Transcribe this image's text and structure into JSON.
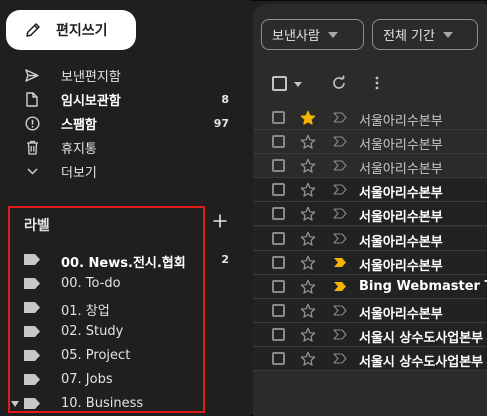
{
  "compose": {
    "label": "편지쓰기",
    "icon": "pencil-icon"
  },
  "nav": [
    {
      "name": "sent",
      "label": "보낸편지함",
      "icon": "send-icon",
      "bold": false,
      "count": ""
    },
    {
      "name": "drafts",
      "label": "임시보관함",
      "icon": "draft-file-icon",
      "bold": true,
      "count": "8"
    },
    {
      "name": "spam",
      "label": "스팸함",
      "icon": "spam-alert-icon",
      "bold": true,
      "count": "97"
    },
    {
      "name": "trash",
      "label": "휴지통",
      "icon": "trash-icon",
      "bold": false,
      "count": ""
    },
    {
      "name": "more",
      "label": "더보기",
      "icon": "chevron-down-icon",
      "bold": false,
      "count": ""
    }
  ],
  "labels_section": {
    "title": "라벨",
    "add_icon": "plus-icon",
    "items": [
      {
        "label": "00. News.전시.협회",
        "bold": true,
        "count": "2"
      },
      {
        "label": "00. To-do",
        "bold": false,
        "count": ""
      },
      {
        "label": "01. 창업",
        "bold": false,
        "count": ""
      },
      {
        "label": "02. Study",
        "bold": false,
        "count": ""
      },
      {
        "label": "05. Project",
        "bold": false,
        "count": ""
      },
      {
        "label": "07. Jobs",
        "bold": false,
        "count": ""
      },
      {
        "label": "10. Business",
        "bold": false,
        "count": ""
      }
    ]
  },
  "filters": [
    {
      "label": "보낸사람"
    },
    {
      "label": "전체 기간"
    }
  ],
  "toolbar": {
    "select_icon": "checkbox-icon",
    "refresh_icon": "refresh-icon",
    "more_icon": "more-vert-icon"
  },
  "colors": {
    "highlight_box": "#e01b1b",
    "star": "#f4b400",
    "important": "#f4b400"
  },
  "emails": [
    {
      "sender": "서울아리수본부",
      "unread": false,
      "starred": true,
      "important": false
    },
    {
      "sender": "서울아리수본부",
      "unread": false,
      "starred": false,
      "important": false
    },
    {
      "sender": "서울아리수본부",
      "unread": false,
      "starred": false,
      "important": false
    },
    {
      "sender": "서울아리수본부",
      "unread": true,
      "starred": false,
      "important": false
    },
    {
      "sender": "서울아리수본부",
      "unread": true,
      "starred": false,
      "important": false
    },
    {
      "sender": "서울아리수본부",
      "unread": true,
      "starred": false,
      "important": false
    },
    {
      "sender": "서울아리수본부",
      "unread": true,
      "starred": false,
      "important": true
    },
    {
      "sender": "Bing Webmaster To",
      "unread": true,
      "starred": false,
      "important": true
    },
    {
      "sender": "서울아리수본부",
      "unread": true,
      "starred": false,
      "important": false
    },
    {
      "sender": "서울시 상수도사업본부",
      "unread": true,
      "starred": false,
      "important": false
    },
    {
      "sender": "서울시 상수도사업본부",
      "unread": true,
      "starred": false,
      "important": false
    }
  ]
}
